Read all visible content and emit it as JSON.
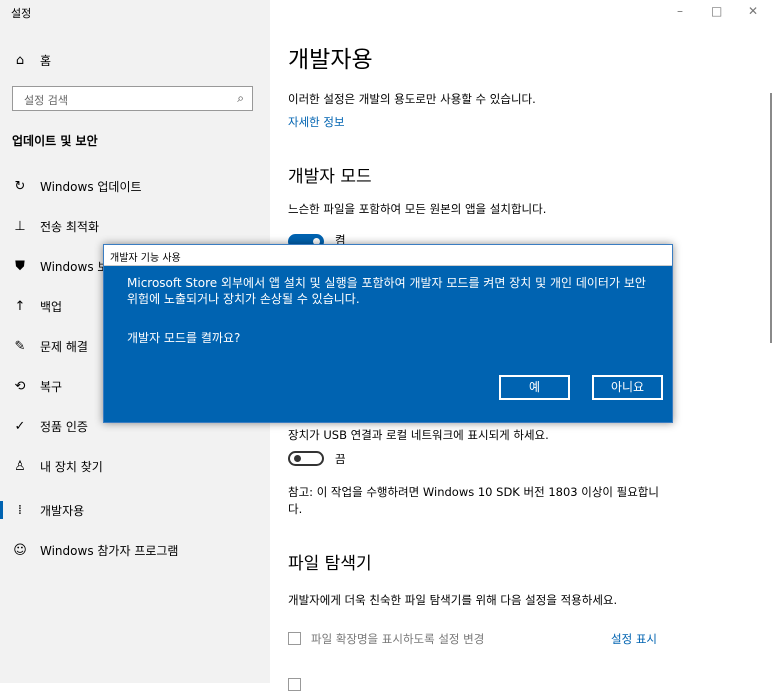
{
  "window": {
    "title": "설정",
    "minimize": "–",
    "maximize": "□",
    "close": "✕"
  },
  "sidebar": {
    "home": {
      "icon": "⌂",
      "label": "홈"
    },
    "search": {
      "placeholder": "설정 검색",
      "icon": "⌕"
    },
    "section_title": "업데이트 및 보안",
    "items": [
      {
        "icon": "↻",
        "label": "Windows 업데이트"
      },
      {
        "icon": "⊥",
        "label": "전송 최적화"
      },
      {
        "icon": "⛊",
        "label": "Windows 보안"
      },
      {
        "icon": "↑",
        "label": "백업"
      },
      {
        "icon": "✎",
        "label": "문제 해결"
      },
      {
        "icon": "⟲",
        "label": "복구"
      },
      {
        "icon": "✓",
        "label": "정품 인증"
      },
      {
        "icon": "♙",
        "label": "내 장치 찾기"
      },
      {
        "icon": "⁞",
        "label": "개발자용"
      },
      {
        "icon": "☺",
        "label": "Windows 참가자 프로그램"
      }
    ],
    "selected_index": 8
  },
  "main": {
    "title": "개발자용",
    "intro": "이러한 설정은 개발의 용도로만 사용할 수 있습니다.",
    "more_info": "자세한 정보",
    "dev_mode": {
      "heading": "개발자 모드",
      "desc": "느슨한 파일을 포함하여 모든 원본의 앱을 설치합니다.",
      "toggle_label": "켬",
      "toggle_on": true
    },
    "device_portal": {
      "desc": "장치가 USB 연결과 로컬 네트워크에 표시되게 하세요.",
      "toggle_label": "끔",
      "toggle_on": false,
      "note": "참고: 이 작업을 수행하려면 Windows 10 SDK 버전 1803 이상이 필요합니다."
    },
    "file_explorer": {
      "heading": "파일 탐색기",
      "desc": "개발자에게 더욱 친숙한 파일 탐색기를 위해 다음 설정을 적용하세요.",
      "option1": "파일 확장명을 표시하도록 설정 변경",
      "option1_link": "설정 표시"
    }
  },
  "dialog": {
    "title": "개발자 기능 사용",
    "message": "Microsoft Store 외부에서 앱 설치 및 실행을 포함하여 개발자 모드를 켜면 장치 및 개인 데이터가 보안 위험에 노출되거나 장치가 손상될 수 있습니다.",
    "question": "개발자 모드를 켤까요?",
    "yes": "예",
    "no": "아니요"
  },
  "colors": {
    "accent": "#0063b1",
    "sidebar_bg": "#f2f2f2"
  }
}
